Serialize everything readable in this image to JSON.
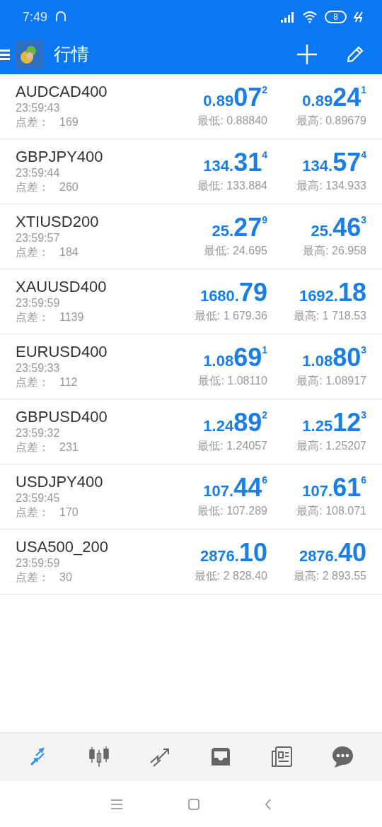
{
  "status_bar": {
    "time": "7:49",
    "battery": "8"
  },
  "toolbar": {
    "title": "行情"
  },
  "quotes": [
    {
      "symbol": "AUDCAD400",
      "time": "23:59:43",
      "spread_label": "点差：",
      "spread": "169",
      "bid": {
        "head": "0.89",
        "big": "07",
        "sup": "2"
      },
      "ask": {
        "head": "0.89",
        "big": "24",
        "sup": "1"
      },
      "low": "最低: 0.88840",
      "high": "最高: 0.89679"
    },
    {
      "symbol": "GBPJPY400",
      "time": "23:59:44",
      "spread_label": "点差：",
      "spread": "260",
      "bid": {
        "head": "134.",
        "big": "31",
        "sup": "4"
      },
      "ask": {
        "head": "134.",
        "big": "57",
        "sup": "4"
      },
      "low": "最低: 133.884",
      "high": "最高: 134.933"
    },
    {
      "symbol": "XTIUSD200",
      "time": "23:59:57",
      "spread_label": "点差：",
      "spread": "184",
      "bid": {
        "head": "25.",
        "big": "27",
        "sup": "9"
      },
      "ask": {
        "head": "25.",
        "big": "46",
        "sup": "3"
      },
      "low": "最低: 24.695",
      "high": "最高: 26.958"
    },
    {
      "symbol": "XAUUSD400",
      "time": "23:59:59",
      "spread_label": "点差：",
      "spread": "1139",
      "bid": {
        "head": "1680.",
        "big": "79"
      },
      "ask": {
        "head": "1692.",
        "big": "18"
      },
      "low": "最低: 1 679.36",
      "high": "最高: 1 718.53"
    },
    {
      "symbol": "EURUSD400",
      "time": "23:59:33",
      "spread_label": "点差：",
      "spread": "112",
      "bid": {
        "head": "1.08",
        "big": "69",
        "sup": "1"
      },
      "ask": {
        "head": "1.08",
        "big": "80",
        "sup": "3"
      },
      "low": "最低: 1.08110",
      "high": "最高: 1.08917"
    },
    {
      "symbol": "GBPUSD400",
      "time": "23:59:32",
      "spread_label": "点差：",
      "spread": "231",
      "bid": {
        "head": "1.24",
        "big": "89",
        "sup": "2"
      },
      "ask": {
        "head": "1.25",
        "big": "12",
        "sup": "3"
      },
      "low": "最低: 1.24057",
      "high": "最高: 1.25207"
    },
    {
      "symbol": "USDJPY400",
      "time": "23:59:45",
      "spread_label": "点差：",
      "spread": "170",
      "bid": {
        "head": "107.",
        "big": "44",
        "sup": "6"
      },
      "ask": {
        "head": "107.",
        "big": "61",
        "sup": "6"
      },
      "low": "最低: 107.289",
      "high": "最高: 108.071"
    },
    {
      "symbol": "USA500_200",
      "time": "23:59:59",
      "spread_label": "点差：",
      "spread": "30",
      "bid": {
        "head": "2876.",
        "big": "10"
      },
      "ask": {
        "head": "2876.",
        "big": "40"
      },
      "low": "最低: 2 828.40",
      "high": "最高: 2 893.55"
    }
  ],
  "bottom_nav": [
    {
      "kind": "quotes",
      "selected": true
    },
    {
      "kind": "chart",
      "selected": false
    },
    {
      "kind": "trade",
      "selected": false
    },
    {
      "kind": "history",
      "selected": false
    },
    {
      "kind": "news",
      "selected": false
    },
    {
      "kind": "chat",
      "selected": false
    }
  ]
}
